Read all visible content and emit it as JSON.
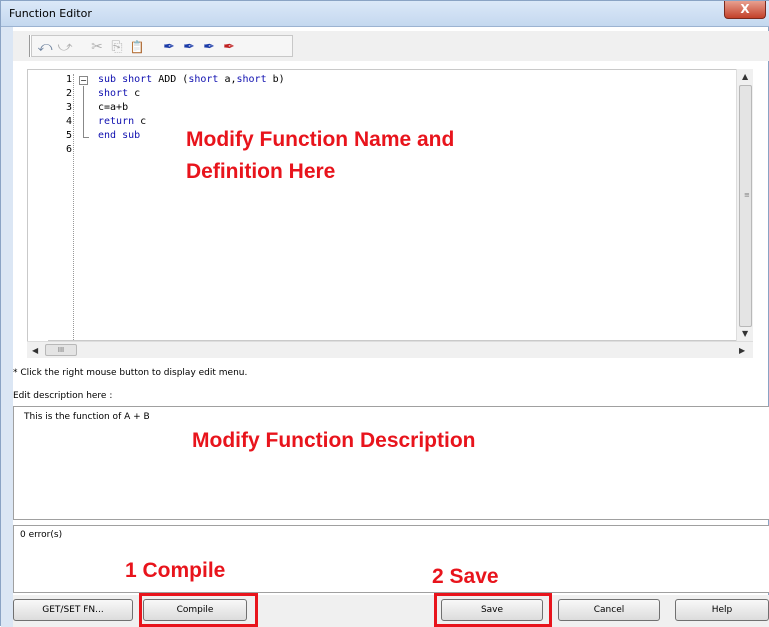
{
  "window": {
    "title": "Function Editor",
    "close_label": "X"
  },
  "toolbar": {
    "buttons": [
      {
        "name": "undo",
        "glyph": "⤺"
      },
      {
        "name": "redo",
        "glyph": "⤻"
      },
      {
        "name": "cut",
        "glyph": "✂"
      },
      {
        "name": "copy",
        "glyph": "⎘"
      },
      {
        "name": "paste",
        "glyph": "📋"
      },
      {
        "name": "bookmark-toggle",
        "glyph": "✒"
      },
      {
        "name": "bookmark-next",
        "glyph": "✒"
      },
      {
        "name": "bookmark-prev",
        "glyph": "✒"
      },
      {
        "name": "bookmark-clear",
        "glyph": "✒"
      }
    ]
  },
  "editor": {
    "line_numbers": [
      "1",
      "2",
      "3",
      "4",
      "5",
      "6"
    ],
    "lines": [
      {
        "kw1": "sub short",
        "rest": " ADD (",
        "kw2": "short",
        "mid": " a,",
        "kw3": "short",
        "end": " b)"
      },
      {
        "kw1": "short",
        "rest": " c"
      },
      {
        "plain": "c=a+b"
      },
      {
        "kw1": "return",
        "rest": " c"
      },
      {
        "kw1": "end sub",
        "rest": ""
      }
    ],
    "fold_glyph": "−",
    "annotation_line1": "Modify Function Name and",
    "annotation_line2": "Definition Here"
  },
  "scroll": {
    "grip": "≡",
    "hgrip": "III",
    "up": "▲",
    "down": "▼",
    "left": "◀",
    "right": "▶"
  },
  "hint_text": "* Click the right mouse button to display edit menu.",
  "description": {
    "label": "Edit description here :",
    "value": "This is the function of A + B",
    "annotation": "Modify Function Description"
  },
  "errors": {
    "text": "0 error(s)"
  },
  "annotations": {
    "compile": "1  Compile",
    "save": "2  Save"
  },
  "buttons": {
    "getset": "GET/SET FN...",
    "compile": "Compile",
    "save": "Save",
    "cancel": "Cancel",
    "help": "Help"
  },
  "colors": {
    "annotation": "#e8141c",
    "keyword": "#1010b0"
  }
}
